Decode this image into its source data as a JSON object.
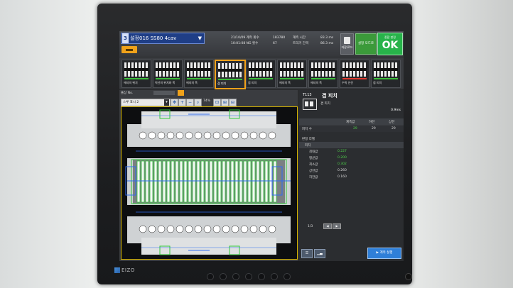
{
  "header": {
    "prog_number": "3",
    "prog_name": "설정016 SS80 4cav",
    "info": [
      "21/10/09  계측 횟수",
      "10:01:08  NG 횟수",
      "183780",
      "67",
      "계측 시간",
      "트리거 간격",
      "83.3 ms",
      "86.3 ms"
    ],
    "save_label": "저장/로드",
    "mode_label": "설정 모드로",
    "ok_sub": "종합 판정",
    "ok_text": "OK"
  },
  "tools": [
    {
      "label": "에지의 위치",
      "status": "ok"
    },
    {
      "label": "직선의 위치와 폭",
      "status": "ok"
    },
    {
      "label": "에지의 폭",
      "status": "ok"
    },
    {
      "label": "겹 피치",
      "status": "ok",
      "active": true
    },
    {
      "label": "겹 피치",
      "status": "ok"
    },
    {
      "label": "에지의 폭",
      "status": "ok"
    },
    {
      "label": "에지의 폭",
      "status": "ok"
    },
    {
      "label": "수직 선선",
      "status": "ng"
    },
    {
      "label": "겹 피치",
      "status": "ok"
    }
  ],
  "left_panel": {
    "header_label": "출상 No.",
    "camera_select": "스루 표시 2",
    "zoom": "74%"
  },
  "result": {
    "tool_code": "T113",
    "tool_name": "겹 피치",
    "tool_sub": "겹 피치",
    "value": "0.9ms",
    "columns": [
      "계측값",
      "하한",
      "상한"
    ],
    "rows": [
      {
        "label": "피치 수",
        "measured": "29",
        "lower": "29",
        "upper": "29"
      }
    ],
    "judge_title": "판정 라벨",
    "judge_group": "피치",
    "judge_items": [
      {
        "label": "최대값",
        "value": "0.227"
      },
      {
        "label": "평균값",
        "value": "0.200"
      },
      {
        "label": "최소값",
        "value": "0.302"
      },
      {
        "label": "상한값",
        "value": "0.260"
      },
      {
        "label": "하한값",
        "value": "0.160"
      }
    ],
    "page": "1/3",
    "run_label": "계측 실행"
  },
  "bezel": {
    "brand": "EIZO"
  },
  "colors": {
    "accent": "#f0a21a",
    "ok": "#27b34a",
    "ng": "#e03b2f",
    "run": "#2f7fd8"
  }
}
